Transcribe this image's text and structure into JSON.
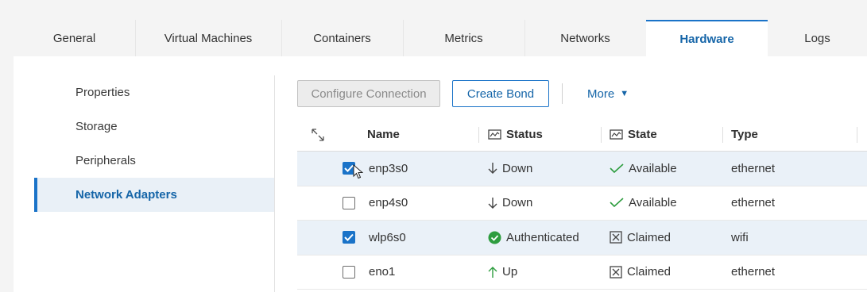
{
  "tabs": [
    "General",
    "Virtual Machines",
    "Containers",
    "Metrics",
    "Networks",
    "Hardware",
    "Logs"
  ],
  "active_tab": "Hardware",
  "sidenav": {
    "items": [
      "Properties",
      "Storage",
      "Peripherals",
      "Network Adapters"
    ],
    "active": "Network Adapters"
  },
  "toolbar": {
    "configure_label": "Configure Connection",
    "create_bond_label": "Create Bond",
    "more_label": "More"
  },
  "table": {
    "columns": {
      "name": "Name",
      "status": "Status",
      "state": "State",
      "type": "Type"
    },
    "rows": [
      {
        "name": "enp3s0",
        "status": "Down",
        "status_icon": "arrow-down-icon",
        "state": "Available",
        "state_icon": "checkmark-icon",
        "type": "ethernet",
        "checked": true
      },
      {
        "name": "enp4s0",
        "status": "Down",
        "status_icon": "arrow-down-icon",
        "state": "Available",
        "state_icon": "checkmark-icon",
        "type": "ethernet",
        "checked": false
      },
      {
        "name": "wlp6s0",
        "status": "Authenticated",
        "status_icon": "check-circle-icon",
        "state": "Claimed",
        "state_icon": "x-box-icon",
        "type": "wifi",
        "checked": true
      },
      {
        "name": "eno1",
        "status": "Up",
        "status_icon": "arrow-up-icon",
        "state": "Claimed",
        "state_icon": "x-box-icon",
        "type": "ethernet",
        "checked": false
      }
    ]
  },
  "colors": {
    "accent": "#1a73c8",
    "status_up": "#2e9d3f",
    "status_ok": "#2e9d3f"
  }
}
